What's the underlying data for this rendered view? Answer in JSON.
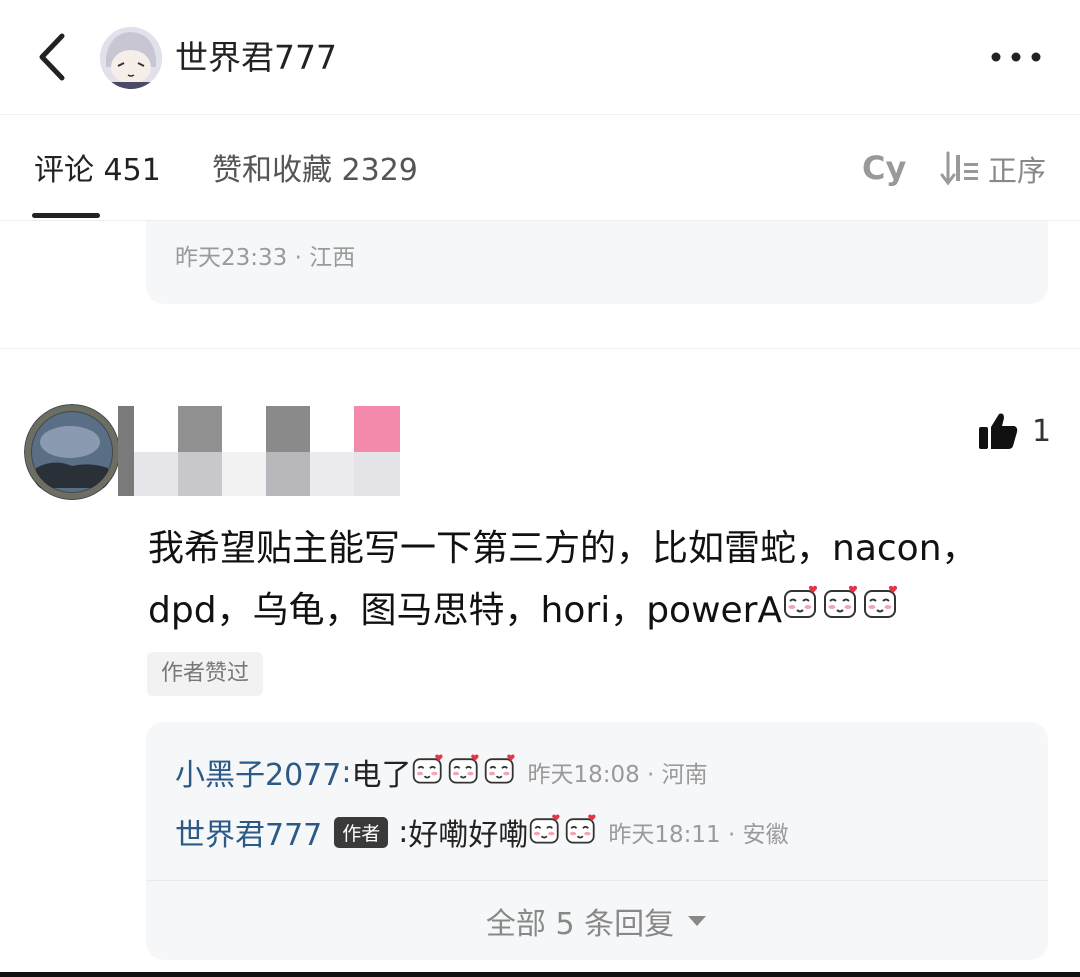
{
  "header": {
    "title": "世界君777"
  },
  "tabs": {
    "comments": "评论 451",
    "likes": "赞和收藏 2329",
    "filter": "Cy",
    "sort": "正序"
  },
  "previous_reply": {
    "meta": "昨天23:33 · 江西"
  },
  "comment": {
    "likes": "1",
    "text": "我希望贴主能写一下第三方的，比如雷蛇，nacon，dpd，乌龟，图马思特，hori，powerA",
    "author_liked": "作者赞过"
  },
  "replies": [
    {
      "user": "小黑子2077",
      "text": "电了",
      "meta": "昨天18:08 · 河南"
    },
    {
      "user": "世界君777",
      "tag": "作者",
      "text": "好嘞好嘞",
      "meta": "昨天18:11 · 安徽"
    }
  ],
  "view_all": "全部 5 条回复",
  "colors": {
    "link_blue": "#2c5a86",
    "mosaic_pink": "#f48aab"
  }
}
